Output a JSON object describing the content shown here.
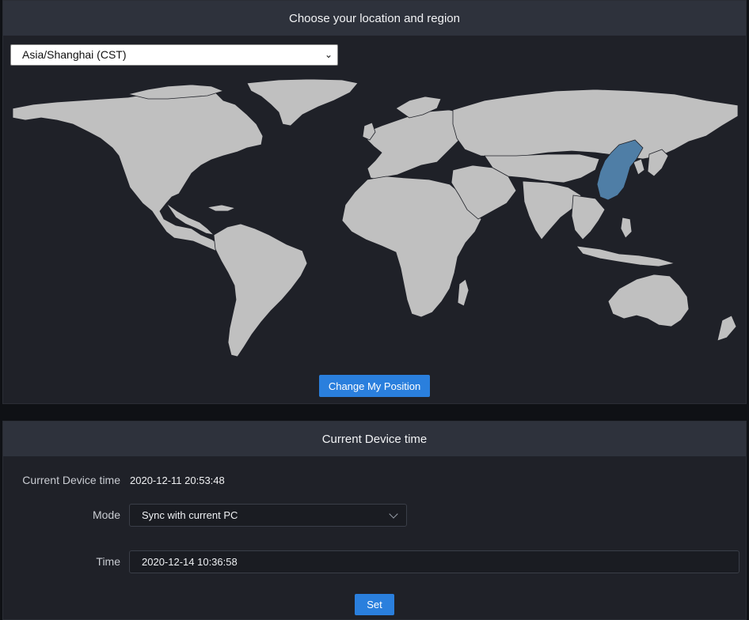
{
  "location_panel": {
    "title": "Choose your location and region",
    "timezone": {
      "selected": "Asia/Shanghai (CST)"
    },
    "map": {
      "land_color": "#c0c0c0",
      "ocean_color": "#1f2128",
      "highlight_color": "#4f7ea6",
      "highlighted_region": "China"
    },
    "change_position_label": "Change My Position"
  },
  "time_panel": {
    "title": "Current Device time",
    "device_time_label": "Current Device time",
    "device_time_value": "2020-12-11 20:53:48",
    "mode_label": "Mode",
    "mode_value": "Sync with current PC",
    "time_label": "Time",
    "time_value": "2020-12-14 10:36:58",
    "set_label": "Set"
  },
  "colors": {
    "accent": "#2a7fdd",
    "panel_bg": "#1f2128",
    "header_bg": "#2e323c"
  }
}
